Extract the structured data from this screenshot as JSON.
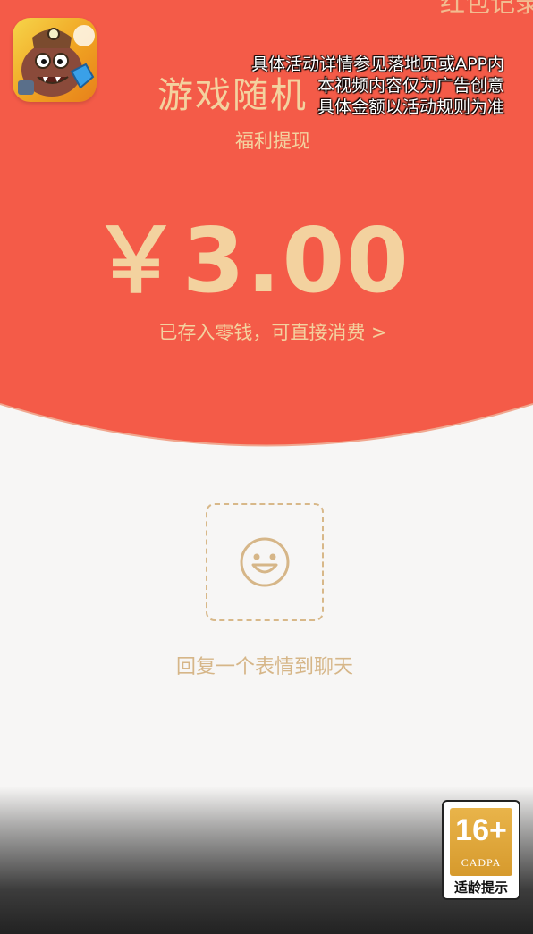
{
  "header": {
    "corner_text": "红包记录",
    "title": "游戏随机",
    "subtitle": "福利提现"
  },
  "disclaimer": {
    "line1": "具体活动详情参见落地页或APP内",
    "line2": "本视频内容仅为广告创意",
    "line3": "具体金额以活动规则为准"
  },
  "packet": {
    "amount": "￥3.00",
    "balance_link": "已存入零钱，可直接消费 >"
  },
  "reply": {
    "label": "回复一个表情到聊天",
    "icon": "smiley-face-icon"
  },
  "age_rating": {
    "number": "16+",
    "org": "CADPA",
    "caption": "适龄提示"
  },
  "colors": {
    "red": "#f45b48",
    "gold": "#f3d29f",
    "background": "#f7f6f5"
  }
}
